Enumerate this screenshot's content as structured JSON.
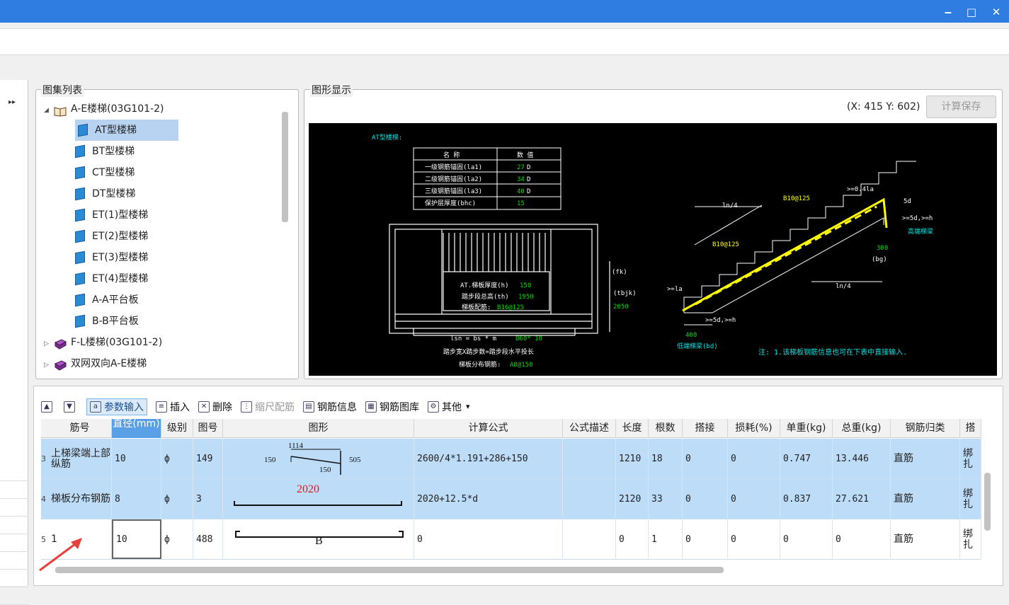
{
  "window": {
    "minimize_icon": "minimize-icon",
    "maximize_icon": "maximize-icon",
    "close_icon": "close-icon"
  },
  "atlas": {
    "title": "图集列表",
    "nodes": [
      {
        "label": "A-E楼梯(03G101-2)",
        "level": 0,
        "expanded": true,
        "icon": "open-book-icon"
      },
      {
        "label": "AT型楼梯",
        "level": 1,
        "selected": true,
        "icon": "page-icon"
      },
      {
        "label": "BT型楼梯",
        "level": 1,
        "icon": "page-icon"
      },
      {
        "label": "CT型楼梯",
        "level": 1,
        "icon": "page-icon"
      },
      {
        "label": "DT型楼梯",
        "level": 1,
        "icon": "page-icon"
      },
      {
        "label": "ET(1)型楼梯",
        "level": 1,
        "icon": "page-icon"
      },
      {
        "label": "ET(2)型楼梯",
        "level": 1,
        "icon": "page-icon"
      },
      {
        "label": "ET(3)型楼梯",
        "level": 1,
        "icon": "page-icon"
      },
      {
        "label": "ET(4)型楼梯",
        "level": 1,
        "icon": "page-icon"
      },
      {
        "label": "A-A平台板",
        "level": 1,
        "icon": "page-icon"
      },
      {
        "label": "B-B平台板",
        "level": 1,
        "icon": "page-icon"
      },
      {
        "label": "F-L楼梯(03G101-2)",
        "level": 0,
        "expanded": false,
        "icon": "closed-book-icon"
      },
      {
        "label": "双网双向A-E楼梯",
        "level": 0,
        "expanded": false,
        "icon": "closed-book-icon"
      }
    ]
  },
  "display": {
    "title": "图形显示",
    "coords": "(X: 415 Y: 602)",
    "calc_save": "计算保存",
    "drawing": {
      "title": "AT型楼梯:",
      "table_head": [
        "名 称",
        "数 值"
      ],
      "table_rows": [
        [
          "一级钢筋锚固(la1)",
          "27",
          "D"
        ],
        [
          "二级钢筋锚固(la2)",
          "34",
          "D"
        ],
        [
          "三级钢筋锚固(la3)",
          "40",
          "D"
        ],
        [
          "保护层厚度(bhc)",
          "15",
          ""
        ]
      ],
      "plan_notes": [
        "AT.梯板厚度(h)",
        "150",
        "踏步段总高(th)",
        "1950",
        "梯板配筋:",
        "B16@125"
      ],
      "plan_dims": [
        "(fk)",
        "(tbjk)",
        "2050"
      ],
      "formula_line": [
        "lsn = bs * m",
        "B60* 10"
      ],
      "under_notes": [
        "踏步宽X踏步数=踏步段水平投长",
        "梯板分布钢筋:",
        "A8@150"
      ],
      "section_labels": [
        "ln/4",
        "B10@125",
        ">=0.4la",
        ">=5d,>=h",
        "高端梯梁",
        "B10@125",
        "300",
        "(bg)",
        ">=la",
        ">=5d,>=h",
        "400",
        "ln/4",
        "低端梯梁(bd)",
        "5d"
      ],
      "note": "注: 1.该梯板钢筋信息也可在下表中直接输入."
    }
  },
  "toolbar": {
    "items": [
      {
        "label": "",
        "icon": "move-up-icon"
      },
      {
        "label": "",
        "icon": "move-down-icon"
      },
      {
        "label": "参数输入",
        "icon": "param-input-icon",
        "active": true
      },
      {
        "label": "插入",
        "icon": "insert-icon"
      },
      {
        "label": "删除",
        "icon": "delete-icon"
      },
      {
        "label": "缩尺配筋",
        "icon": "scale-rebar-icon",
        "disabled": true
      },
      {
        "label": "钢筋信息",
        "icon": "rebar-info-icon"
      },
      {
        "label": "钢筋图库",
        "icon": "rebar-library-icon"
      },
      {
        "label": "其他",
        "icon": "other-icon",
        "dropdown": "▾"
      }
    ]
  },
  "grid": {
    "columns": [
      "筋号",
      "直径(mm)",
      "级别",
      "图号",
      "图形",
      "计算公式",
      "公式描述",
      "长度",
      "根数",
      "搭接",
      "损耗(%)",
      "单重(kg)",
      "总重(kg)",
      "钢筋归类",
      "搭"
    ],
    "rows": [
      {
        "index": "3",
        "name": "上梯梁端上部纵筋",
        "dia": "10",
        "grade": "ф",
        "fig": "149",
        "formula": "2600/4*1.191+286+150",
        "desc": "",
        "len": "1210",
        "count": "18",
        "lap": "0",
        "loss": "0",
        "unit": "0.747",
        "total": "13.446",
        "cat": "直筋",
        "tie": "绑扎",
        "shape_text": [
          "1114",
          "150",
          "505",
          "150"
        ]
      },
      {
        "index": "4",
        "name": "梯板分布钢筋",
        "dia": "8",
        "grade": "ф",
        "fig": "3",
        "formula": "2020+12.5*d",
        "desc": "",
        "len": "2120",
        "count": "33",
        "lap": "0",
        "loss": "0",
        "unit": "0.837",
        "total": "27.621",
        "cat": "直筋",
        "tie": "绑扎",
        "shape_text": [
          "2020"
        ]
      },
      {
        "index": "5",
        "name": "1",
        "dia": "10",
        "grade": "ф",
        "fig": "488",
        "formula": "0",
        "desc": "",
        "len": "0",
        "count": "1",
        "lap": "0",
        "loss": "0",
        "unit": "0",
        "total": "0",
        "cat": "直筋",
        "tie": "绑扎",
        "shape_text": [
          "B"
        ]
      }
    ]
  }
}
